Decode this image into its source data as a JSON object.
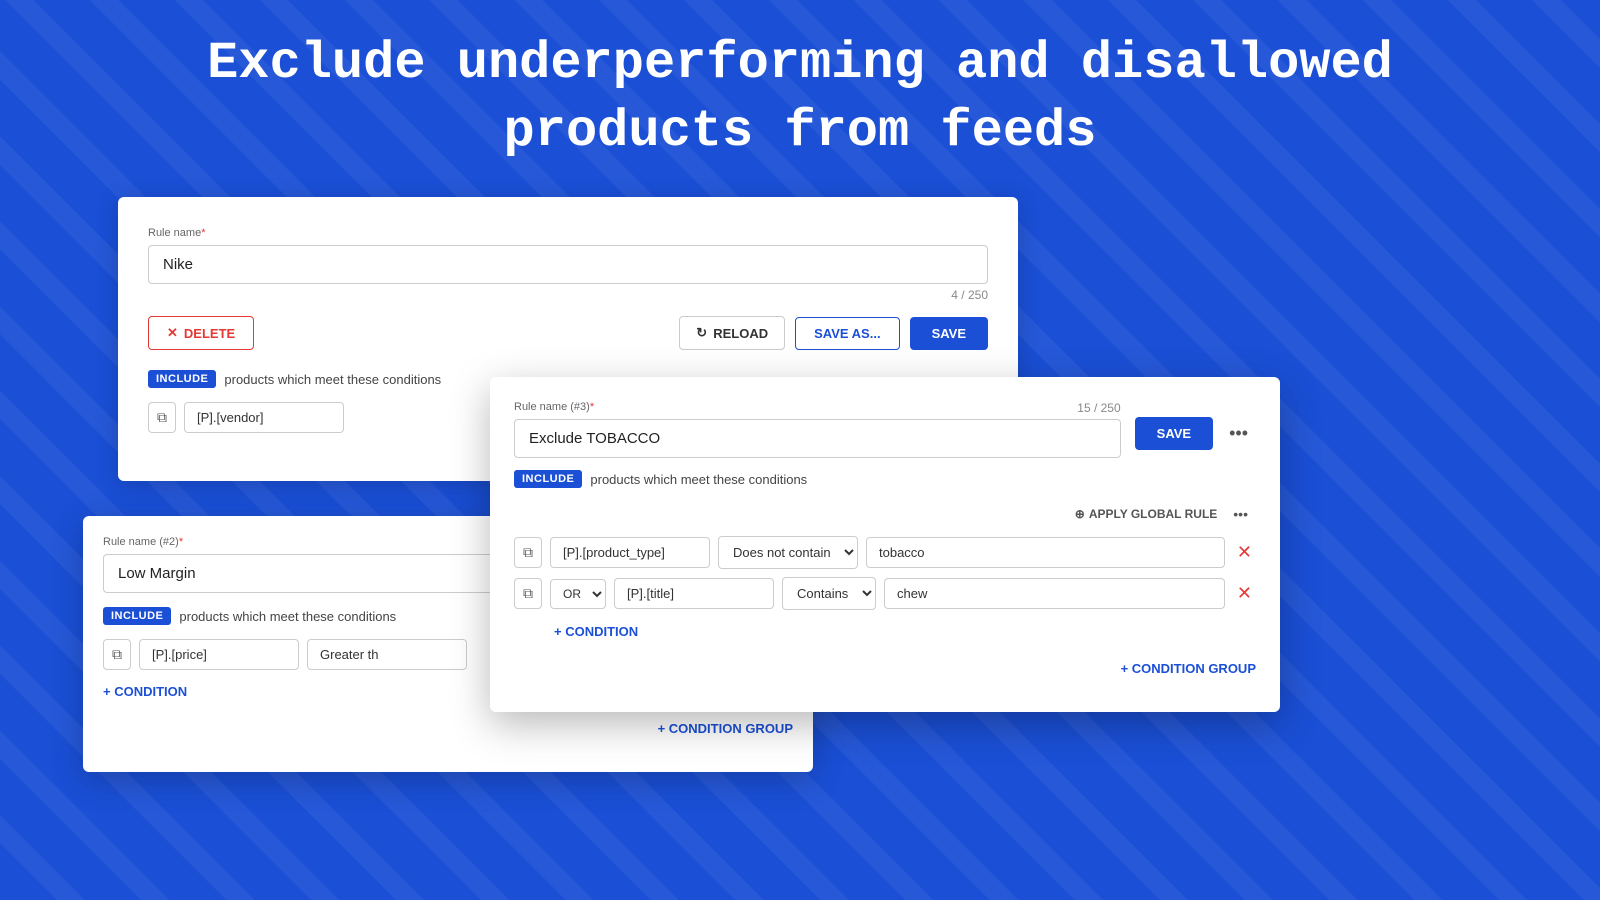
{
  "page": {
    "title_line1": "Exclude underperforming and disallowed",
    "title_line2": "products from feeds"
  },
  "panel1": {
    "rule_label": "Rule name",
    "required_marker": "*",
    "rule_name_value": "Nike",
    "char_count": "4 / 250",
    "delete_label": "DELETE",
    "reload_label": "RELOAD",
    "save_as_label": "SAVE AS...",
    "save_label": "SAVE",
    "include_badge": "INCLUDE",
    "section_desc": "products which meet these conditions",
    "condition_field": "[P].[vendor]"
  },
  "panel2": {
    "rule_label": "Rule name (#2)",
    "required_marker": "*",
    "rule_name_value": "Low Margin",
    "include_badge": "INCLUDE",
    "section_desc": "products which meet these conditions",
    "condition_field": "[P].[price]",
    "condition_operator_partial": "Greater th",
    "add_condition_label": "+ CONDITION",
    "add_condition_group_label": "+ CONDITION GROUP"
  },
  "panel3": {
    "rule_label": "Rule name (#3)",
    "required_marker": "*",
    "char_count": "15 / 250",
    "rule_name_value": "Exclude TOBACCO",
    "save_label": "SAVE",
    "more_icon": "•••",
    "include_badge": "INCLUDE",
    "section_desc": "products which meet these conditions",
    "apply_global_label": "APPLY GLOBAL RULE",
    "apply_more_icon": "•••",
    "row1": {
      "field": "[P].[product_type]",
      "operator": "Does not contain",
      "value": "tobacco"
    },
    "row2": {
      "or_label": "OR",
      "field": "[P].[title]",
      "operator": "Contains",
      "value": "chew"
    },
    "add_condition_label": "+ CONDITION",
    "add_condition_group_label": "+ CONDITION GROUP"
  }
}
